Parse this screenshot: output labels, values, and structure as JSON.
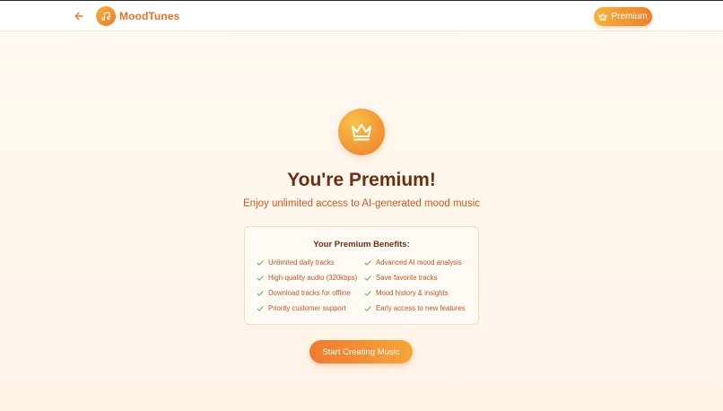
{
  "header": {
    "brand_name": "MoodTunes",
    "back_icon": "arrow-left-icon",
    "logo_icon": "music-note-icon",
    "premium_button": {
      "label": "Premium",
      "icon": "crown-icon"
    }
  },
  "hero": {
    "icon": "crown-icon",
    "title": "You're Premium!",
    "subtitle": "Enjoy unlimited access to AI-generated mood music"
  },
  "benefits": {
    "title": "Your Premium Benefits:",
    "items": [
      "Unlimited daily tracks",
      "Advanced AI mood analysis",
      "High-quality audio (320kbps)",
      "Save favorite tracks",
      "Download tracks for offline",
      "Mood history & insights",
      "Priority customer support",
      "Early access to new features"
    ]
  },
  "cta": {
    "label": "Start Creating Music"
  },
  "colors": {
    "accent": "#ec7a2c",
    "accent_light": "#f5b43b",
    "title": "#6b2f14",
    "check": "#4caf50",
    "background": "#fff8ef"
  }
}
